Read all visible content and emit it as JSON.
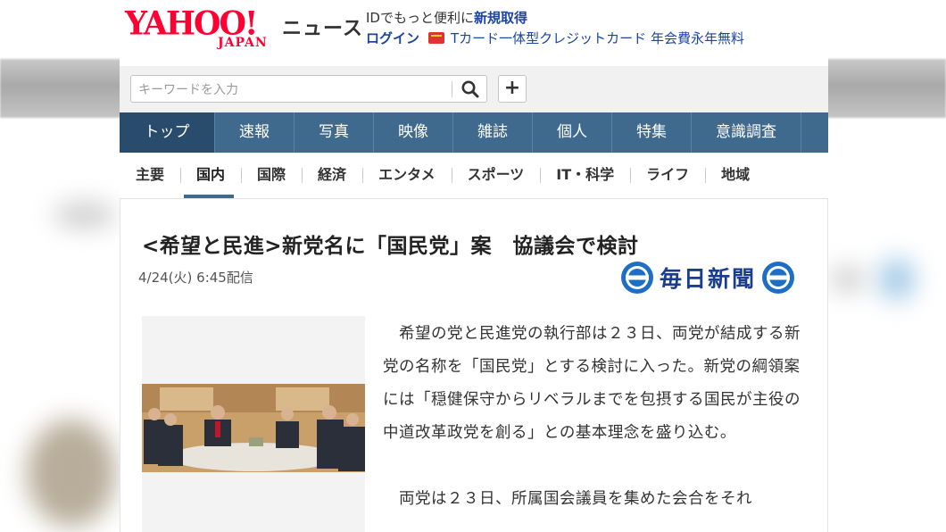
{
  "header": {
    "logo_yahoo": "YAHOO!",
    "logo_japan": "JAPAN",
    "logo_news": "ニュース",
    "promo_prefix": "IDでもっと便利に",
    "promo_link": "新規取得",
    "login": "ログイン",
    "tcard_text": "Tカード一体型クレジットカード 年会費永年無料"
  },
  "search": {
    "placeholder": "キーワードを入力",
    "plus_label": "+"
  },
  "main_nav": {
    "items": [
      {
        "label": "トップ"
      },
      {
        "label": "速報"
      },
      {
        "label": "写真"
      },
      {
        "label": "映像"
      },
      {
        "label": "雑誌"
      },
      {
        "label": "個人"
      },
      {
        "label": "特集"
      },
      {
        "label": "意識調査"
      }
    ],
    "active_index": 0
  },
  "sub_nav": {
    "items": [
      {
        "label": "主要"
      },
      {
        "label": "国内"
      },
      {
        "label": "国際"
      },
      {
        "label": "経済"
      },
      {
        "label": "エンタメ"
      },
      {
        "label": "スポーツ"
      },
      {
        "label": "IT・科学"
      },
      {
        "label": "ライフ"
      },
      {
        "label": "地域"
      }
    ],
    "active_index": 1
  },
  "article": {
    "headline": "<希望と民進>新党名に「国民党」案　協議会で検討",
    "date": "4/24(火) 6:45配信",
    "source": "毎日新聞",
    "paragraphs": [
      "　希望の党と民進党の執行部は２３日、両党が結成する新党の名称を「国民党」とする検討に入った。新党の綱領案には「穏健保守からリベラルまでを包摂する国民が主役の中道改革政党を創る」との基本理念を盛り込む。",
      "　両党は２３日、所属国会議員を集めた会合をそれ"
    ]
  },
  "colors": {
    "brand_red": "#ff0033",
    "nav_blue": "#3f6a8e",
    "nav_active": "#2a4c6c",
    "link_blue": "#1a44a8",
    "mainichi_blue": "#1a3d8c"
  },
  "icons": {
    "search": "magnifier-icon",
    "tcard": "tcard-icon",
    "mainichi_emblem": "mainichi-emblem-icon"
  }
}
